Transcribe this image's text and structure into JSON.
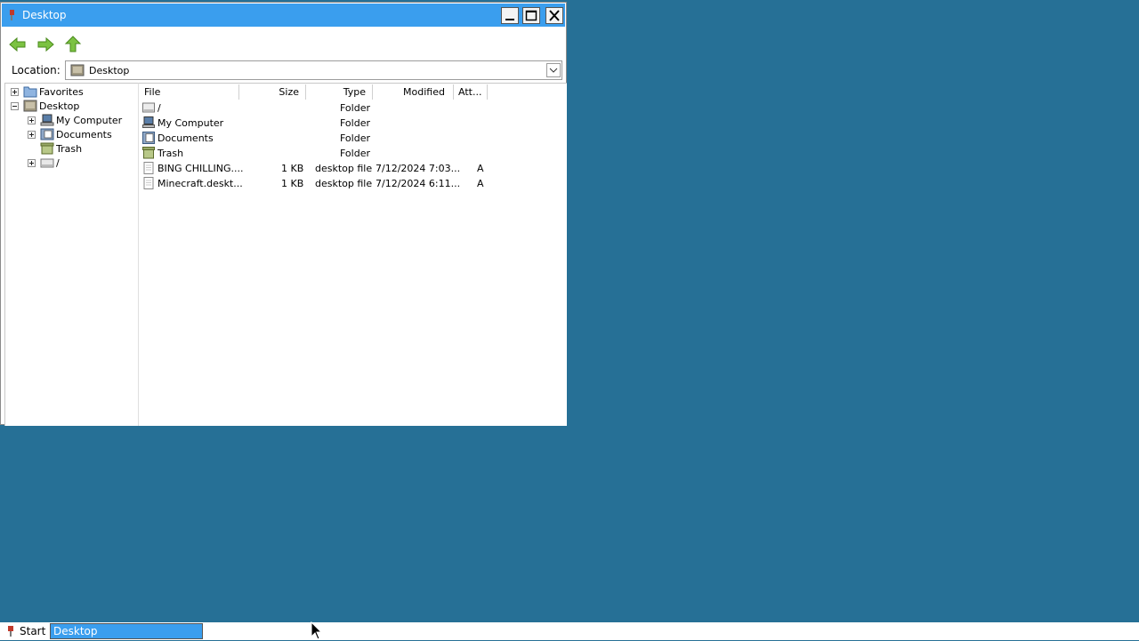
{
  "window": {
    "title": "Desktop",
    "location_label": "Location:",
    "location_value": "Desktop"
  },
  "tree": [
    {
      "label": "Favorites",
      "icon": "favorites-folder-icon",
      "expander": "plus"
    },
    {
      "label": "Desktop",
      "icon": "desktop-icon",
      "expander": "minus"
    },
    {
      "label": "My Computer",
      "icon": "computer-icon",
      "expander": "plus"
    },
    {
      "label": "Documents",
      "icon": "documents-icon",
      "expander": "plus"
    },
    {
      "label": "Trash",
      "icon": "trash-icon",
      "expander": "none"
    },
    {
      "label": "/",
      "icon": "drive-icon",
      "expander": "plus"
    }
  ],
  "list": {
    "headers": {
      "file": "File",
      "size": "Size",
      "type": "Type",
      "modified": "Modified",
      "attr": "Att..."
    },
    "rows": [
      {
        "name": "/",
        "size": "",
        "type": "Folder",
        "modified": "",
        "attr": "",
        "icon": "drive-icon"
      },
      {
        "name": "My Computer",
        "size": "",
        "type": "Folder",
        "modified": "",
        "attr": "",
        "icon": "computer-icon"
      },
      {
        "name": "Documents",
        "size": "",
        "type": "Folder",
        "modified": "",
        "attr": "",
        "icon": "documents-icon"
      },
      {
        "name": "Trash",
        "size": "",
        "type": "Folder",
        "modified": "",
        "attr": "",
        "icon": "trash-icon"
      },
      {
        "name": "BING CHILLING....",
        "size": "1 KB",
        "type": "desktop file",
        "modified": "7/12/2024 7:03...",
        "attr": "A",
        "icon": "file-icon"
      },
      {
        "name": "Minecraft.deskt...",
        "size": "1 KB",
        "type": "desktop file",
        "modified": "7/12/2024 6:11...",
        "attr": "A",
        "icon": "file-icon"
      }
    ]
  },
  "taskbar": {
    "start_label": "Start",
    "task_label": "Desktop"
  },
  "colors": {
    "desktop": "#267096",
    "titlebar": "#3a9eee",
    "nav_arrow": "#6fb52c"
  }
}
